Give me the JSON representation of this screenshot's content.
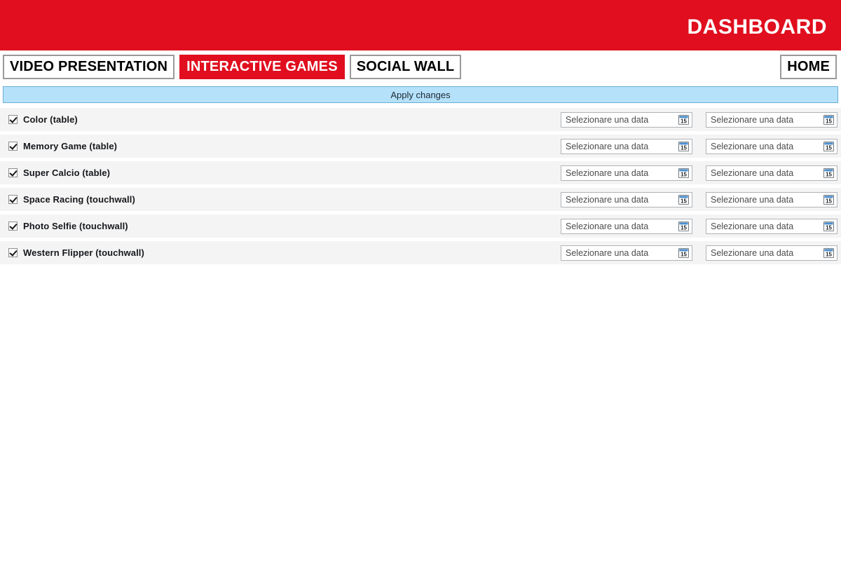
{
  "header": {
    "title": "DASHBOARD",
    "background_color": "#e00e1e",
    "title_color": "#ffffff"
  },
  "tabbar": {
    "tabs": [
      {
        "label": "VIDEO PRESENTATION",
        "active": false
      },
      {
        "label": "INTERACTIVE GAMES",
        "active": true
      },
      {
        "label": "SOCIAL WALL",
        "active": false
      }
    ],
    "home_label": "HOME",
    "active_color": "#e00e1e"
  },
  "apply_bar": {
    "label": "Apply changes",
    "background_color": "#b5e2fa",
    "border_color": "#6aaed6"
  },
  "rows": [
    {
      "label": "Color (table)",
      "checked": true,
      "date_from": {
        "placeholder": "Selezionare una data",
        "value": ""
      },
      "date_to": {
        "placeholder": "Selezionare una data",
        "value": ""
      }
    },
    {
      "label": "Memory Game (table)",
      "checked": true,
      "date_from": {
        "placeholder": "Selezionare una data",
        "value": ""
      },
      "date_to": {
        "placeholder": "Selezionare una data",
        "value": ""
      }
    },
    {
      "label": "Super Calcio (table)",
      "checked": true,
      "date_from": {
        "placeholder": "Selezionare una data",
        "value": ""
      },
      "date_to": {
        "placeholder": "Selezionare una data",
        "value": ""
      }
    },
    {
      "label": "Space Racing (touchwall)",
      "checked": true,
      "date_from": {
        "placeholder": "Selezionare una data",
        "value": ""
      },
      "date_to": {
        "placeholder": "Selezionare una data",
        "value": ""
      }
    },
    {
      "label": "Photo Selfie (touchwall)",
      "checked": true,
      "date_from": {
        "placeholder": "Selezionare una data",
        "value": ""
      },
      "date_to": {
        "placeholder": "Selezionare una data",
        "value": ""
      }
    },
    {
      "label": "Western Flipper (touchwall)",
      "checked": true,
      "date_from": {
        "placeholder": "Selezionare una data",
        "value": ""
      },
      "date_to": {
        "placeholder": "Selezionare una data",
        "value": ""
      }
    }
  ],
  "icons": {
    "calendar": "calendar-icon",
    "calendar_day_number": "15"
  }
}
